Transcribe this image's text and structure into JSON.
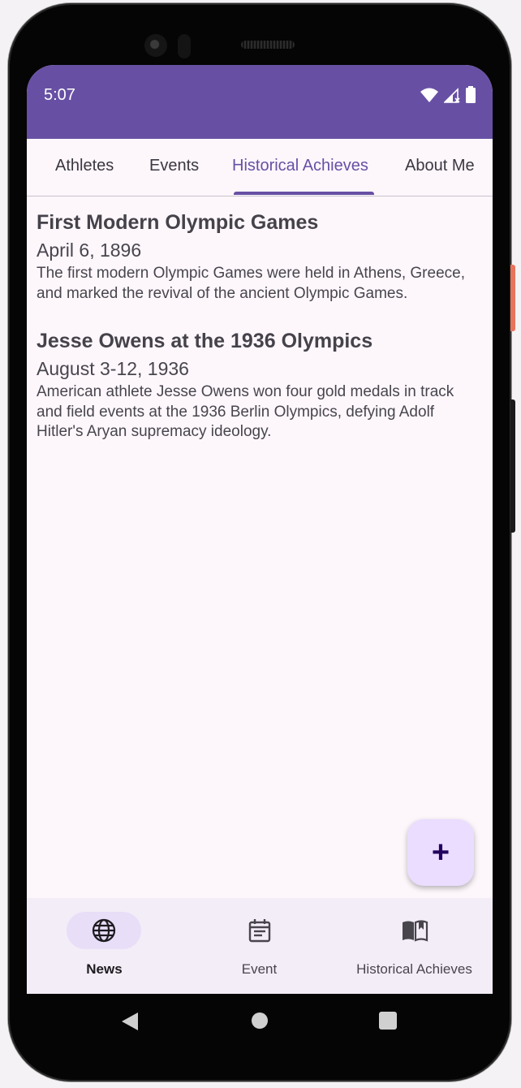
{
  "status_bar": {
    "time": "5:07"
  },
  "tabs": [
    {
      "label": "Athletes",
      "active": false
    },
    {
      "label": "Events",
      "active": false
    },
    {
      "label": "Historical Achieves",
      "active": true
    },
    {
      "label": "About Me",
      "active": false
    }
  ],
  "achievements": [
    {
      "title": "First Modern Olympic Games",
      "date": "April 6, 1896",
      "description": "The first modern Olympic Games were held in Athens, Greece, and marked the revival of the ancient Olympic Games."
    },
    {
      "title": "Jesse Owens at the 1936 Olympics",
      "date": "August 3-12, 1936",
      "description": "American athlete Jesse Owens won four gold medals in track and field events at the 1936 Berlin Olympics, defying Adolf Hitler's Aryan supremacy ideology."
    }
  ],
  "fab": {
    "icon": "plus-icon",
    "label": "+"
  },
  "bottom_nav": [
    {
      "label": "News",
      "icon": "globe-icon",
      "active": true
    },
    {
      "label": "Event",
      "icon": "calendar-icon",
      "active": false
    },
    {
      "label": "Historical Achieves",
      "icon": "book-icon",
      "active": false
    }
  ],
  "colors": {
    "primary": "#6750a4",
    "background": "#fdf7fc",
    "nav_background": "#f3edf7",
    "active_pill": "#e8def8",
    "fab_background": "#eaddff"
  }
}
